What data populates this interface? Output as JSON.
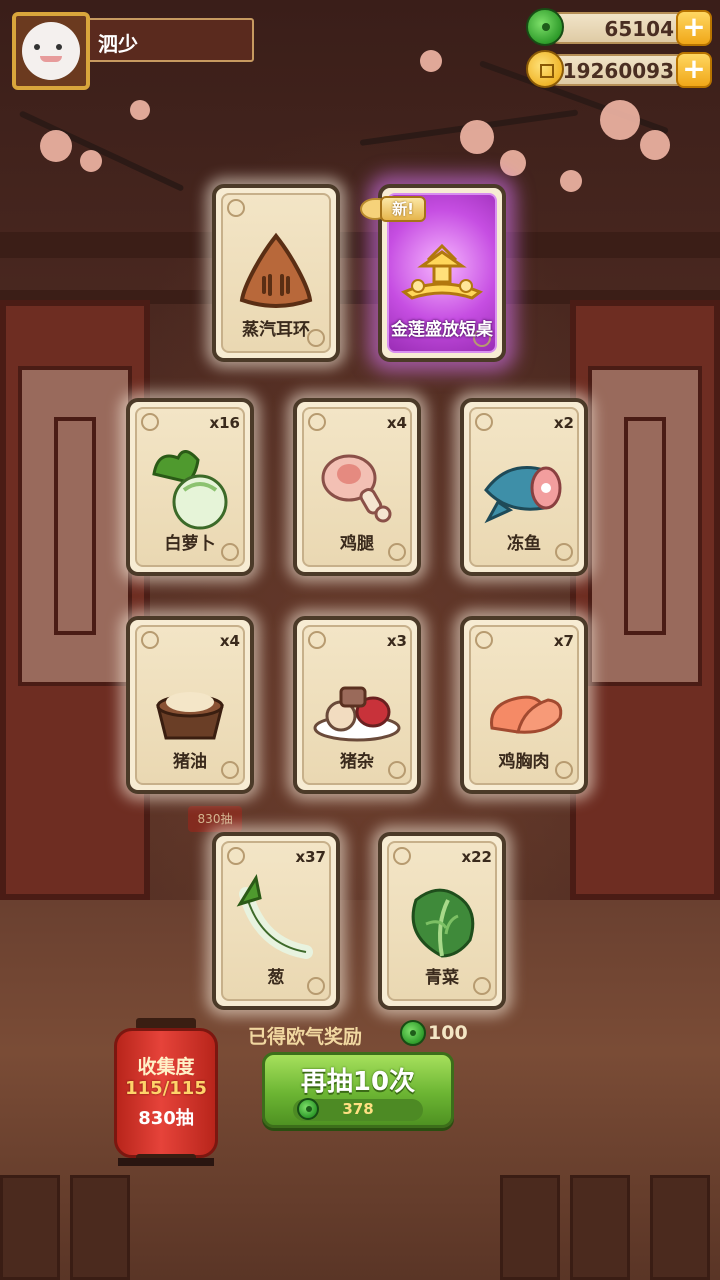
{
  "player": {
    "name": "泗少"
  },
  "resources": {
    "jade": {
      "value": "65104",
      "icon": "jade-icon"
    },
    "coins": {
      "value": "19260093",
      "icon": "coin-icon"
    }
  },
  "cards": [
    {
      "label": "蒸汽耳环",
      "count": "",
      "art": "bun-icon",
      "is_new": false,
      "special": false
    },
    {
      "label": "金莲盛放短桌",
      "count": "",
      "art": "pavilion-table-icon",
      "is_new": true,
      "new_label": "新!",
      "special": true
    },
    {
      "label": "白萝卜",
      "count": "x16",
      "art": "turnip-icon",
      "is_new": false,
      "special": false
    },
    {
      "label": "鸡腿",
      "count": "x4",
      "art": "drumstick-icon",
      "is_new": false,
      "special": false
    },
    {
      "label": "冻鱼",
      "count": "x2",
      "art": "fish-icon",
      "is_new": false,
      "special": false
    },
    {
      "label": "猪油",
      "count": "x4",
      "art": "lard-bowl-icon",
      "is_new": false,
      "special": false
    },
    {
      "label": "猪杂",
      "count": "x3",
      "art": "offal-plate-icon",
      "is_new": false,
      "special": false
    },
    {
      "label": "鸡胸肉",
      "count": "x7",
      "art": "chicken-breast-icon",
      "is_new": false,
      "special": false
    },
    {
      "label": "葱",
      "count": "x37",
      "art": "scallion-icon",
      "is_new": false,
      "special": false
    },
    {
      "label": "青菜",
      "count": "x22",
      "art": "greens-icon",
      "is_new": false,
      "special": false
    }
  ],
  "collection": {
    "title": "收集度",
    "progress": "115/115",
    "draws": "830抽"
  },
  "reward": {
    "label": "已得欧气奖励",
    "value": "100"
  },
  "draw_button": {
    "label": "再抽10次",
    "cost": "378"
  },
  "background_badge": "830抽"
}
